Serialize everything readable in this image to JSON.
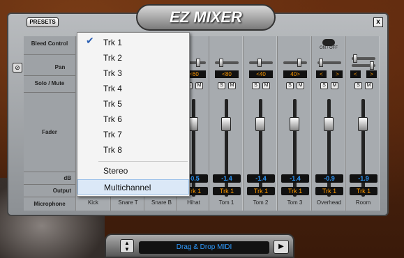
{
  "app": {
    "title": "EZ MIXER",
    "presets_label": "PRESETS",
    "close_label": "x"
  },
  "row_labels": {
    "bleed": "Bleed Control",
    "pan": "Pan",
    "solo": "Solo / Mute",
    "fader": "Fader",
    "db": "dB",
    "output": "Output",
    "mic": "Microphone"
  },
  "switch": {
    "label": "ON / OFF"
  },
  "channels": [
    {
      "name": "Hihat",
      "pan": "<60",
      "db": "-0.5",
      "out": "Trk 1",
      "s": "S",
      "m": "M"
    },
    {
      "name": "Tom 1",
      "pan": "<80",
      "db": "-1.4",
      "out": "Trk 1",
      "s": "S",
      "m": "M"
    },
    {
      "name": "Tom 2",
      "pan": "<40",
      "db": "-1.4",
      "out": "Trk 1",
      "s": "S",
      "m": "M"
    },
    {
      "name": "Tom 3",
      "pan": "40>",
      "db": "-1.4",
      "out": "Trk 1",
      "s": "S",
      "m": "M"
    },
    {
      "name": "Overhead",
      "pan_l": "<",
      "pan_r": ">",
      "db": "-0.9",
      "out": "Trk 1",
      "s": "S",
      "m": "M"
    },
    {
      "name": "Room",
      "pan_l": "<",
      "pan_r": ">",
      "db": "-1.9",
      "out": "Trk 1",
      "s": "S",
      "m": "M"
    }
  ],
  "hidden_channels": {
    "kick": "Kick",
    "snare_t": "Snare T",
    "snare_b": "Snare B"
  },
  "menu": {
    "items": [
      "Trk 1",
      "Trk 2",
      "Trk 3",
      "Trk 4",
      "Trk 5",
      "Trk 6",
      "Trk 7",
      "Trk 8",
      "Stereo",
      "Multichannel"
    ],
    "checked": "Trk 1",
    "highlighted": "Multichannel"
  },
  "bottom": {
    "drag_label": "Drag & Drop MIDI"
  }
}
